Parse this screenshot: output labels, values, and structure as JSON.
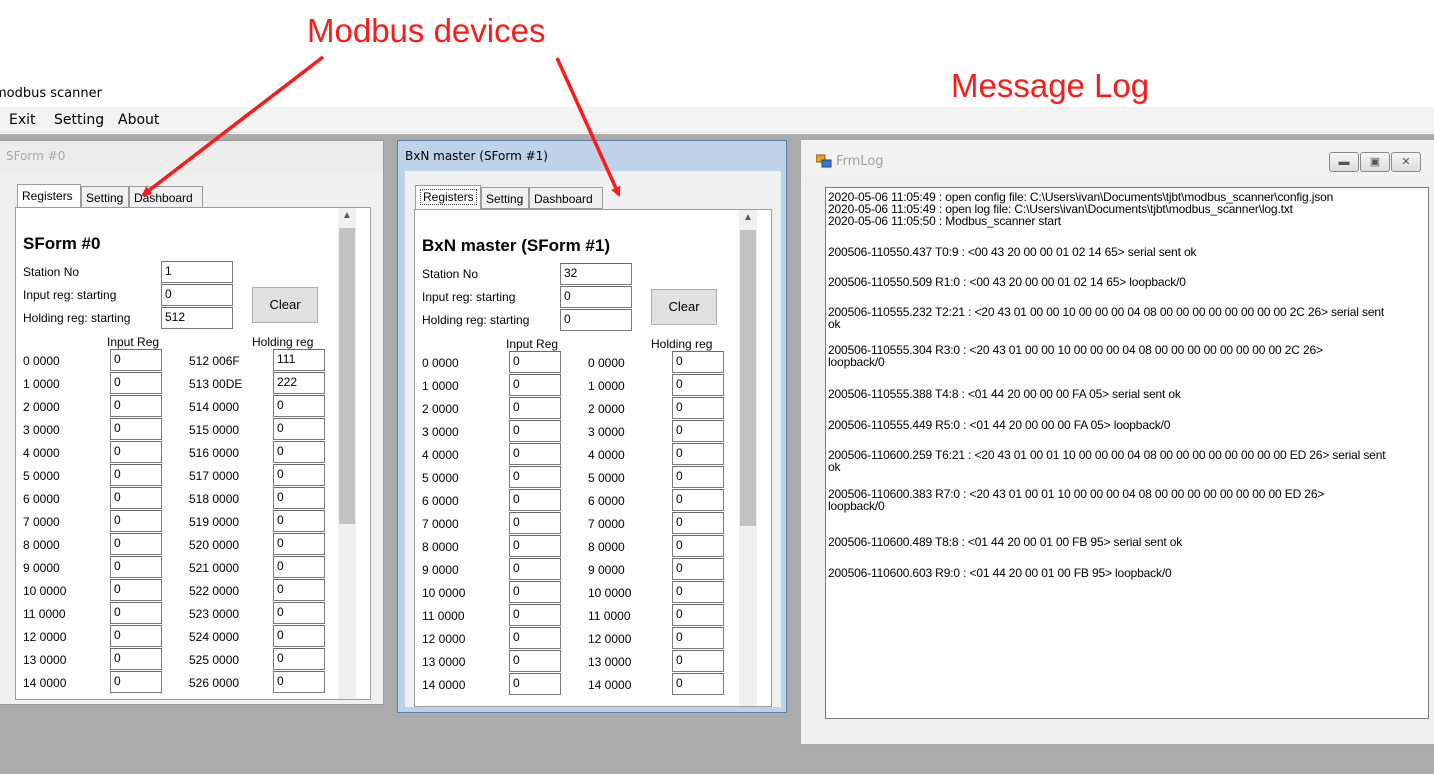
{
  "annotations": {
    "modbus_devices": "Modbus devices",
    "message_log": "Message Log"
  },
  "app": {
    "title": "modbus scanner",
    "menu": [
      "Exit",
      "Setting",
      "About"
    ]
  },
  "colors": {
    "annotation": "#ff1a1a",
    "mdi_background": "#ababab",
    "active_frame": "#bed2e8"
  },
  "forms": [
    {
      "window_title": "SForm #0",
      "tabs": [
        "Registers",
        "Setting",
        "Dashboard"
      ],
      "selected_tab": "Registers",
      "heading": "SForm #0",
      "labels": {
        "station_no": "Station No",
        "input_start": "Input reg: starting",
        "holding_start": "Holding reg: starting",
        "input_col": "Input Reg",
        "holding_col": "Holding reg",
        "clear": "Clear"
      },
      "station_no": "1",
      "input_start": "0",
      "holding_start": "512",
      "rows": [
        {
          "in_label": "0 0000",
          "in_val": "0",
          "h_label": "512 006F",
          "h_val": "111"
        },
        {
          "in_label": "1 0000",
          "in_val": "0",
          "h_label": "513 00DE",
          "h_val": "222"
        },
        {
          "in_label": "2 0000",
          "in_val": "0",
          "h_label": "514 0000",
          "h_val": "0"
        },
        {
          "in_label": "3 0000",
          "in_val": "0",
          "h_label": "515 0000",
          "h_val": "0"
        },
        {
          "in_label": "4 0000",
          "in_val": "0",
          "h_label": "516 0000",
          "h_val": "0"
        },
        {
          "in_label": "5 0000",
          "in_val": "0",
          "h_label": "517 0000",
          "h_val": "0"
        },
        {
          "in_label": "6 0000",
          "in_val": "0",
          "h_label": "518 0000",
          "h_val": "0"
        },
        {
          "in_label": "7 0000",
          "in_val": "0",
          "h_label": "519 0000",
          "h_val": "0"
        },
        {
          "in_label": "8 0000",
          "in_val": "0",
          "h_label": "520 0000",
          "h_val": "0"
        },
        {
          "in_label": "9 0000",
          "in_val": "0",
          "h_label": "521 0000",
          "h_val": "0"
        },
        {
          "in_label": "10 0000",
          "in_val": "0",
          "h_label": "522 0000",
          "h_val": "0"
        },
        {
          "in_label": "11 0000",
          "in_val": "0",
          "h_label": "523 0000",
          "h_val": "0"
        },
        {
          "in_label": "12 0000",
          "in_val": "0",
          "h_label": "524 0000",
          "h_val": "0"
        },
        {
          "in_label": "13 0000",
          "in_val": "0",
          "h_label": "525 0000",
          "h_val": "0"
        },
        {
          "in_label": "14 0000",
          "in_val": "0",
          "h_label": "526 0000",
          "h_val": "0"
        }
      ]
    },
    {
      "window_title": "BxN master (SForm #1)",
      "tabs": [
        "Registers",
        "Setting",
        "Dashboard"
      ],
      "selected_tab": "Registers",
      "heading": "BxN master (SForm #1)",
      "labels": {
        "station_no": "Station No",
        "input_start": "Input reg: starting",
        "holding_start": "Holding reg: starting",
        "input_col": "Input Reg",
        "holding_col": "Holding reg",
        "clear": "Clear"
      },
      "station_no": "32",
      "input_start": "0",
      "holding_start": "0",
      "rows": [
        {
          "in_label": "0 0000",
          "in_val": "0",
          "h_label": "0 0000",
          "h_val": "0"
        },
        {
          "in_label": "1 0000",
          "in_val": "0",
          "h_label": "1 0000",
          "h_val": "0"
        },
        {
          "in_label": "2 0000",
          "in_val": "0",
          "h_label": "2 0000",
          "h_val": "0"
        },
        {
          "in_label": "3 0000",
          "in_val": "0",
          "h_label": "3 0000",
          "h_val": "0"
        },
        {
          "in_label": "4 0000",
          "in_val": "0",
          "h_label": "4 0000",
          "h_val": "0"
        },
        {
          "in_label": "5 0000",
          "in_val": "0",
          "h_label": "5 0000",
          "h_val": "0"
        },
        {
          "in_label": "6 0000",
          "in_val": "0",
          "h_label": "6 0000",
          "h_val": "0"
        },
        {
          "in_label": "7 0000",
          "in_val": "0",
          "h_label": "7 0000",
          "h_val": "0"
        },
        {
          "in_label": "8 0000",
          "in_val": "0",
          "h_label": "8 0000",
          "h_val": "0"
        },
        {
          "in_label": "9 0000",
          "in_val": "0",
          "h_label": "9 0000",
          "h_val": "0"
        },
        {
          "in_label": "10 0000",
          "in_val": "0",
          "h_label": "10 0000",
          "h_val": "0"
        },
        {
          "in_label": "11 0000",
          "in_val": "0",
          "h_label": "11 0000",
          "h_val": "0"
        },
        {
          "in_label": "12 0000",
          "in_val": "0",
          "h_label": "12 0000",
          "h_val": "0"
        },
        {
          "in_label": "13 0000",
          "in_val": "0",
          "h_label": "13 0000",
          "h_val": "0"
        },
        {
          "in_label": "14 0000",
          "in_val": "0",
          "h_label": "14 0000",
          "h_val": "0"
        }
      ]
    }
  ],
  "log": {
    "window_title": "FrmLog",
    "lines": [
      "2020-05-06 11:05:49 : open config file: C:\\Users\\ivan\\Documents\\tjbt\\modbus_scanner\\config.json",
      "2020-05-06 11:05:49 : open log file: C:\\Users\\ivan\\Documents\\tjbt\\modbus_scanner\\log.txt",
      "2020-05-06 11:05:50 : Modbus_scanner start",
      "200506-110550.437 T0:9  : <00 43 20 00 00 01 02 14 65> serial sent ok",
      "200506-110550.509 R1:0  : <00 43 20 00 00 01 02 14 65>  loopback/0",
      "200506-110555.232 T2:21  : <20 43 01 00 00 10 00 00 00 04 08 00 00 00 00 00 00 00 00 2C 26> serial sent",
      "ok",
      "200506-110555.304 R3:0  : <20 43 01 00 00 10 00 00 00 04 08 00 00 00 00 00 00 00 00 2C 26>",
      "loopback/0",
      "200506-110555.388 T4:8  : <01 44 20 00 00 00 FA 05> serial sent ok",
      "200506-110555.449 R5:0  : <01 44 20 00 00 00 FA 05>  loopback/0",
      "200506-110600.259 T6:21  : <20 43 01 00 01 10 00 00 00 04 08 00 00 00 00 00 00 00 00 ED 26> serial sent",
      "ok",
      "200506-110600.383 R7:0  : <20 43 01 00 01 10 00 00 00 04 08 00 00 00 00 00 00 00 00 ED 26>",
      "loopback/0",
      "200506-110600.489 T8:8  : <01 44 20 00 01 00 FB 95> serial sent ok",
      "200506-110600.603 R9:0  : <01 44 20 00 01 00 FB 95>  loopback/0"
    ]
  }
}
